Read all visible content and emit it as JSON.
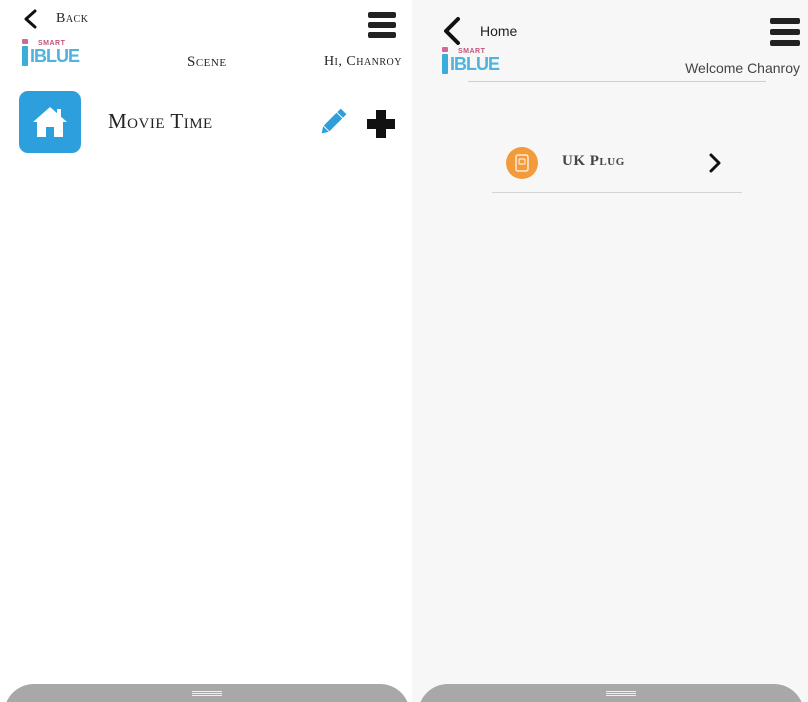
{
  "left_screen": {
    "back_label": "Back",
    "title": "Scene",
    "greeting": "Hi, Chanroy",
    "logo": {
      "smart": "SMART",
      "word": "IBLUE"
    },
    "scenes": [
      {
        "name": "Movie Time",
        "icon": "home-icon"
      }
    ],
    "actions": {
      "edit_icon": "pencil-icon",
      "add_icon": "plus-icon"
    }
  },
  "right_screen": {
    "back_label": "Home",
    "welcome": "Welcome Chanroy",
    "logo": {
      "smart": "SMART",
      "word": "IBLUE"
    },
    "devices": [
      {
        "name": "UK Plug",
        "icon": "plug-icon",
        "color": "#f39b3b"
      }
    ]
  },
  "colors": {
    "scene_tile": "#2e9fdd",
    "pencil": "#2e9fdd",
    "device_icon": "#f39b3b",
    "sheet": "#a8a8a8"
  }
}
